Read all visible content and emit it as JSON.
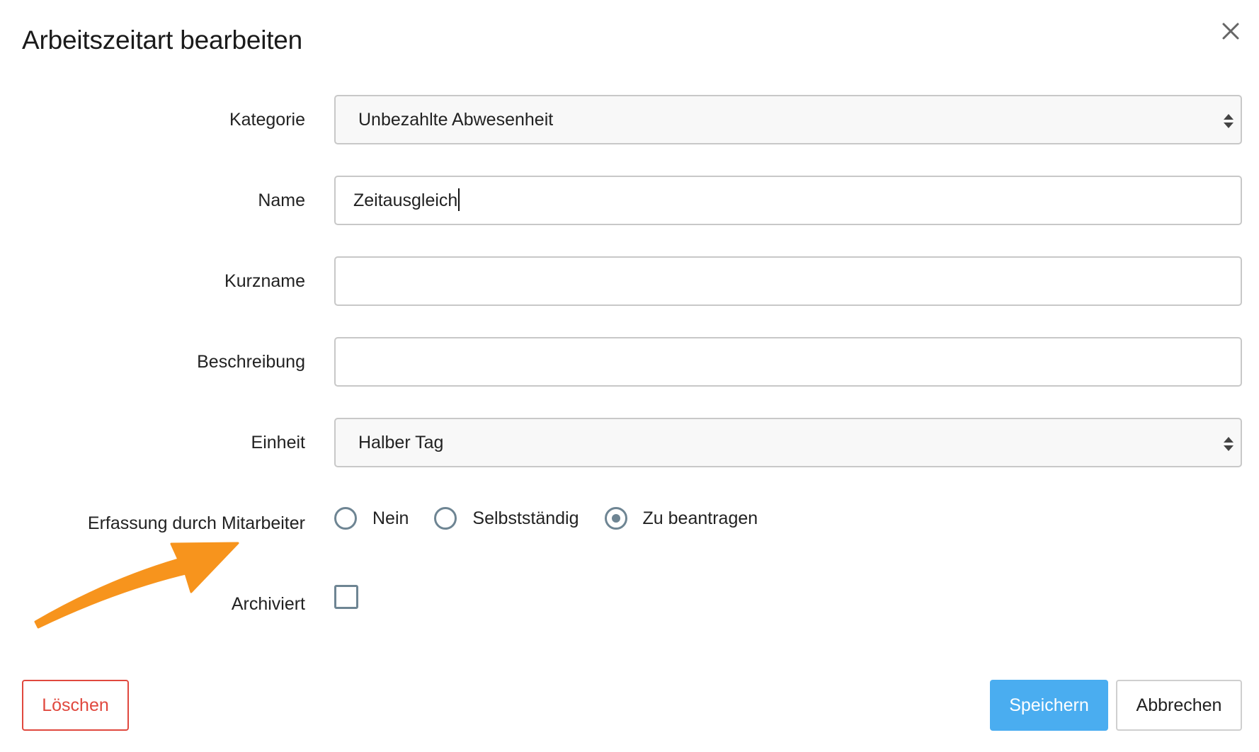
{
  "dialog": {
    "title": "Arbeitszeitart bearbeiten",
    "close_icon": "close-icon"
  },
  "form": {
    "kategorie": {
      "label": "Kategorie",
      "value": "Unbezahlte Abwesenheit"
    },
    "name": {
      "label": "Name",
      "value": "Zeitausgleich"
    },
    "kurzname": {
      "label": "Kurzname",
      "value": ""
    },
    "beschreibung": {
      "label": "Beschreibung",
      "value": ""
    },
    "einheit": {
      "label": "Einheit",
      "value": "Halber Tag"
    },
    "erfassung": {
      "label": "Erfassung durch Mitarbeiter",
      "options": [
        {
          "label": "Nein",
          "checked": false
        },
        {
          "label": "Selbstständig",
          "checked": false
        },
        {
          "label": "Zu beantragen",
          "checked": true
        }
      ]
    },
    "archiviert": {
      "label": "Archiviert",
      "checked": false
    }
  },
  "buttons": {
    "delete_label": "Löschen",
    "save_label": "Speichern",
    "cancel_label": "Abbrechen"
  },
  "colors": {
    "delete": "#e0483e",
    "save": "#4aadf0",
    "control": "#6e8593",
    "annotation_arrow": "#f7941d"
  }
}
